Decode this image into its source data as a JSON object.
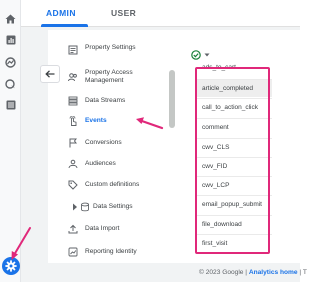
{
  "tabs": {
    "admin": "ADMIN",
    "user": "USER"
  },
  "nav": {
    "items": [
      {
        "label": "Property Settings",
        "icon": "property-settings-icon"
      },
      {
        "label": "Property Access Management",
        "icon": "people-icon"
      },
      {
        "label": "Data Streams",
        "icon": "data-streams-icon"
      },
      {
        "label": "Events",
        "icon": "events-icon"
      },
      {
        "label": "Conversions",
        "icon": "flag-icon"
      },
      {
        "label": "Audiences",
        "icon": "audiences-icon"
      },
      {
        "label": "Custom definitions",
        "icon": "custom-definitions-icon"
      },
      {
        "label": "Data Settings",
        "icon": "database-icon"
      },
      {
        "label": "Data Import",
        "icon": "upload-icon"
      },
      {
        "label": "Reporting Identity",
        "icon": "reporting-identity-icon"
      }
    ],
    "active_index": 3
  },
  "events": [
    "ads_to_cart",
    "article_completed",
    "call_to_action_click",
    "comment",
    "cwv_CLS",
    "cwv_FID",
    "cwv_LCP",
    "email_popup_submit",
    "file_download",
    "first_visit"
  ],
  "footer": {
    "copyright": "© 2023 Google",
    "separator": " | ",
    "link": "Analytics home",
    "tail": " | T"
  },
  "colors": {
    "accent": "#1a73e8",
    "highlight": "#e0287a",
    "status_ok": "#188038"
  }
}
